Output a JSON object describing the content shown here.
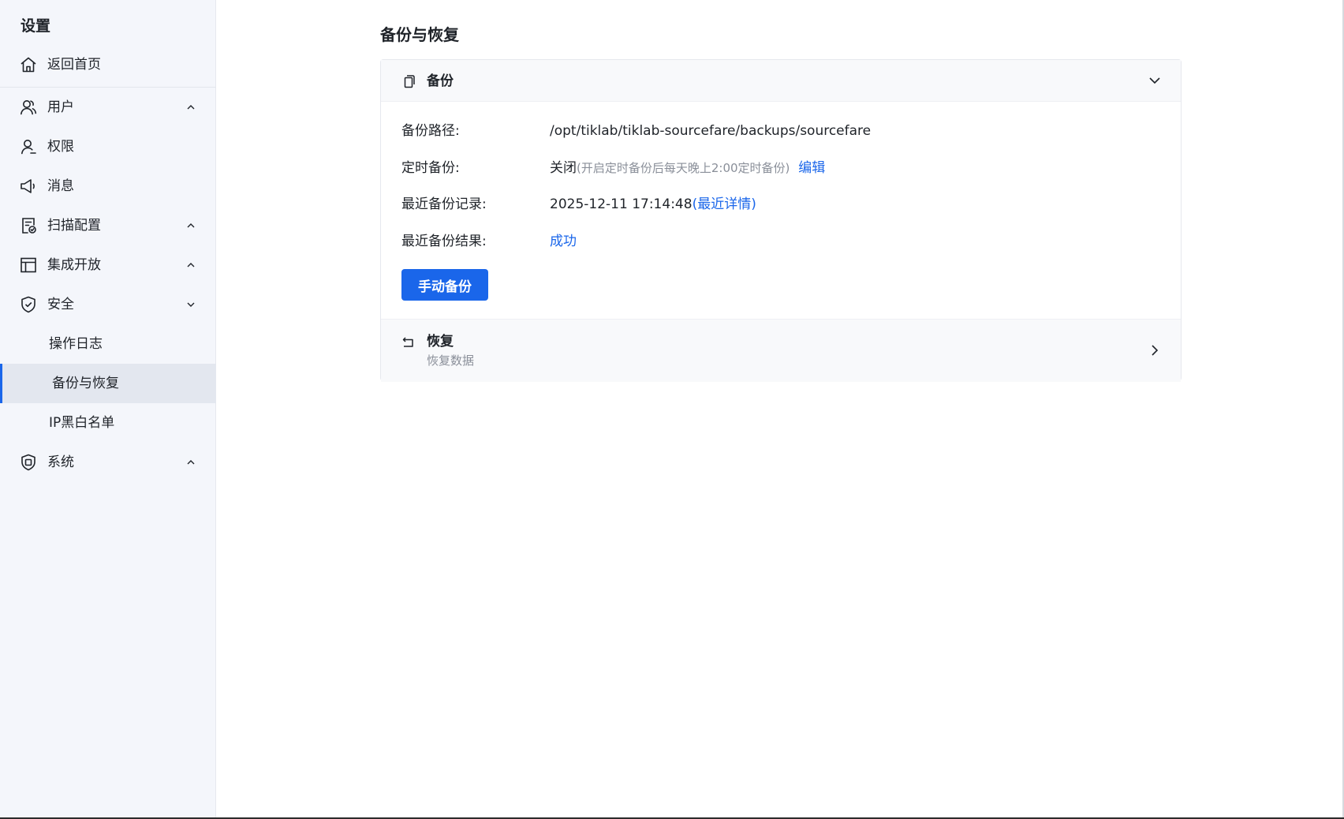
{
  "sidebar": {
    "title": "设置",
    "items": [
      {
        "label": "返回首页",
        "icon": "home-icon"
      },
      {
        "label": "用户",
        "icon": "user-group-icon",
        "chevron": "up"
      },
      {
        "label": "权限",
        "icon": "user-icon"
      },
      {
        "label": "消息",
        "icon": "megaphone-icon"
      },
      {
        "label": "扫描配置",
        "icon": "scan-config-icon",
        "chevron": "up"
      },
      {
        "label": "集成开放",
        "icon": "layout-icon",
        "chevron": "up"
      },
      {
        "label": "安全",
        "icon": "shield-check-icon",
        "chevron": "down"
      },
      {
        "label": "操作日志"
      },
      {
        "label": "备份与恢复",
        "active": true
      },
      {
        "label": "IP黑白名单"
      },
      {
        "label": "系统",
        "icon": "system-shield-icon",
        "chevron": "up"
      }
    ]
  },
  "main": {
    "title": "备份与恢复",
    "backup": {
      "header": "备份",
      "path_label": "备份路径:",
      "path_value": "/opt/tiklab/tiklab-sourcefare/backups/sourcefare",
      "schedule_label": "定时备份:",
      "schedule_value": "关闭",
      "schedule_hint": "(开启定时备份后每天晚上2:00定时备份)",
      "schedule_edit": "编辑",
      "record_label": "最近备份记录:",
      "record_value": "2025-12-11 17:14:48",
      "record_link": "(最近详情)",
      "result_label": "最近备份结果:",
      "result_value": "成功",
      "manual_button": "手动备份"
    },
    "restore": {
      "title": "恢复",
      "subtitle": "恢复数据"
    }
  },
  "colors": {
    "accent": "#1a66ea",
    "sidebar_bg": "#f4f6fb",
    "muted_text": "#8a8f99"
  }
}
